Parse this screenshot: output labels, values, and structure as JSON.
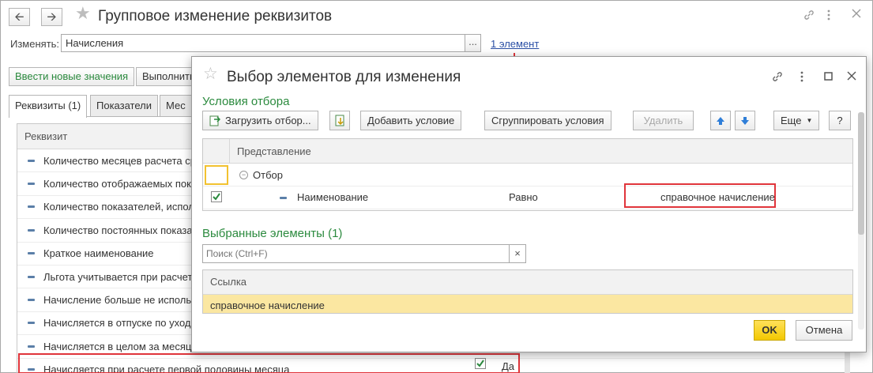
{
  "main_window": {
    "title": "Групповое изменение реквизитов",
    "change_label": "Изменять:",
    "change_value": "Начисления",
    "dots_label": "...",
    "elements_link": "1 элемент",
    "btn_new_values": "Ввести новые значения",
    "btn_execute": "Выполнить",
    "tabs": [
      {
        "label": "Реквизиты (1)"
      },
      {
        "label": "Показатели"
      },
      {
        "label": "Мес"
      }
    ],
    "grid_header": "Реквизит",
    "rows": [
      "Количество месяцев расчета ср",
      "Количество отображаемых пока",
      "Количество показателей, испол",
      "Количество постоянных показа",
      "Краткое наименование",
      "Льгота учитывается при расчет",
      "Начисление больше не исполь:",
      "Начисляется в отпуске по уход",
      "Начисляется в целом за месяц",
      "Начисляется при расчете первой половины месяца"
    ],
    "last_row_value": "Да"
  },
  "dialog": {
    "title": "Выбор элементов для изменения",
    "filter_section": "Условия отбора",
    "btn_load_filter": "Загрузить отбор...",
    "btn_add_condition": "Добавить условие",
    "btn_group_conditions": "Сгруппировать условия",
    "btn_delete": "Удалить",
    "btn_more": "Еще",
    "btn_help": "?",
    "cond_header": "Представление",
    "filter_group": "Отбор",
    "condition": {
      "field": "Наименование",
      "operator": "Равно",
      "value": "справочное начисление"
    },
    "selected_section": "Выбранные элементы (1)",
    "search_placeholder": "Поиск (Ctrl+F)",
    "clear_label": "×",
    "link_header": "Ссылка",
    "link_row": "справочное начисление",
    "btn_ok": "OK",
    "btn_cancel": "Отмена"
  }
}
